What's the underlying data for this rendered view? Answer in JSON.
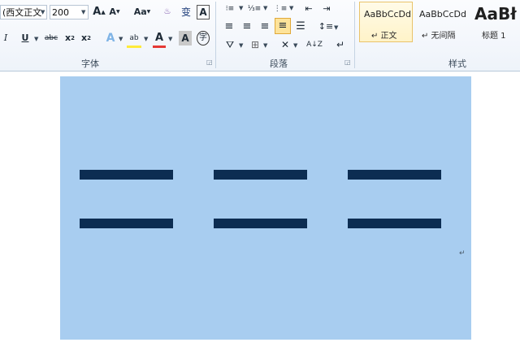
{
  "ribbon": {
    "font_group": {
      "font_name": "(西文正文",
      "font_size": "200",
      "label": "字体"
    },
    "paragraph_group": {
      "label": "段落"
    },
    "styles_group": {
      "label": "样式",
      "cards": [
        {
          "preview": "AaBbCcDd",
          "name": "↵ 正文"
        },
        {
          "preview": "AaBbCcDd",
          "name": "↵ 无间隔"
        },
        {
          "preview": "AaBł",
          "name": "标题 1"
        }
      ]
    }
  },
  "document": {
    "return_mark": "↵"
  },
  "colors": {
    "page": "#a8cdf0",
    "dash": "#0c2d52",
    "accent_highlight": "#ffeb3b",
    "accent_font_color": "#e53935"
  }
}
